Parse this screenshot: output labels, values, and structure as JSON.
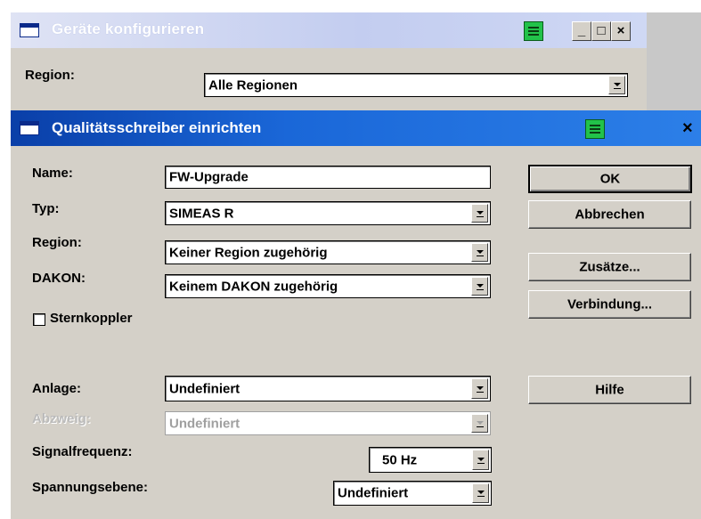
{
  "background_window": {
    "title": "Geräte konfigurieren",
    "region_label": "Region:",
    "region_value": "Alle Regionen",
    "minimize_glyph": "_",
    "maximize_glyph": "□",
    "close_glyph": "×"
  },
  "dialog": {
    "title": "Qualitätsschreiber einrichten",
    "close_glyph": "×",
    "fields": {
      "name_label": "Name:",
      "name_value": "FW-Upgrade",
      "typ_label": "Typ:",
      "typ_value": "SIMEAS R",
      "region_label": "Region:",
      "region_value": "Keiner Region zugehörig",
      "dakon_label": "DAKON:",
      "dakon_value": "Keinem DAKON zugehörig",
      "sternkoppler_label": "Sternkoppler",
      "sternkoppler_checked": false,
      "anlage_label": "Anlage:",
      "anlage_value": "Undefiniert",
      "abzweig_label": "Abzweig:",
      "abzweig_value": "Undefiniert",
      "signalfrequenz_label": "Signalfrequenz:",
      "signalfrequenz_value": "50 Hz",
      "spannungsebene_label": "Spannungsebene:",
      "spannungsebene_value": "Undefiniert"
    },
    "buttons": {
      "ok": "OK",
      "abbrechen": "Abbrechen",
      "zusaetze": "Zusätze...",
      "verbindung": "Verbindung...",
      "hilfe": "Hilfe"
    }
  },
  "colors": {
    "active_title_start": "#0a3fa8",
    "active_title_end": "#2c7fe8",
    "inactive_title": "#c3cdf0",
    "dialog_face": "#d4d0c8",
    "print_button": "#22c24a"
  },
  "icons": [
    "window-icon",
    "print-icon",
    "minimize-icon",
    "maximize-icon",
    "close-icon",
    "dropdown-arrow-icon"
  ]
}
